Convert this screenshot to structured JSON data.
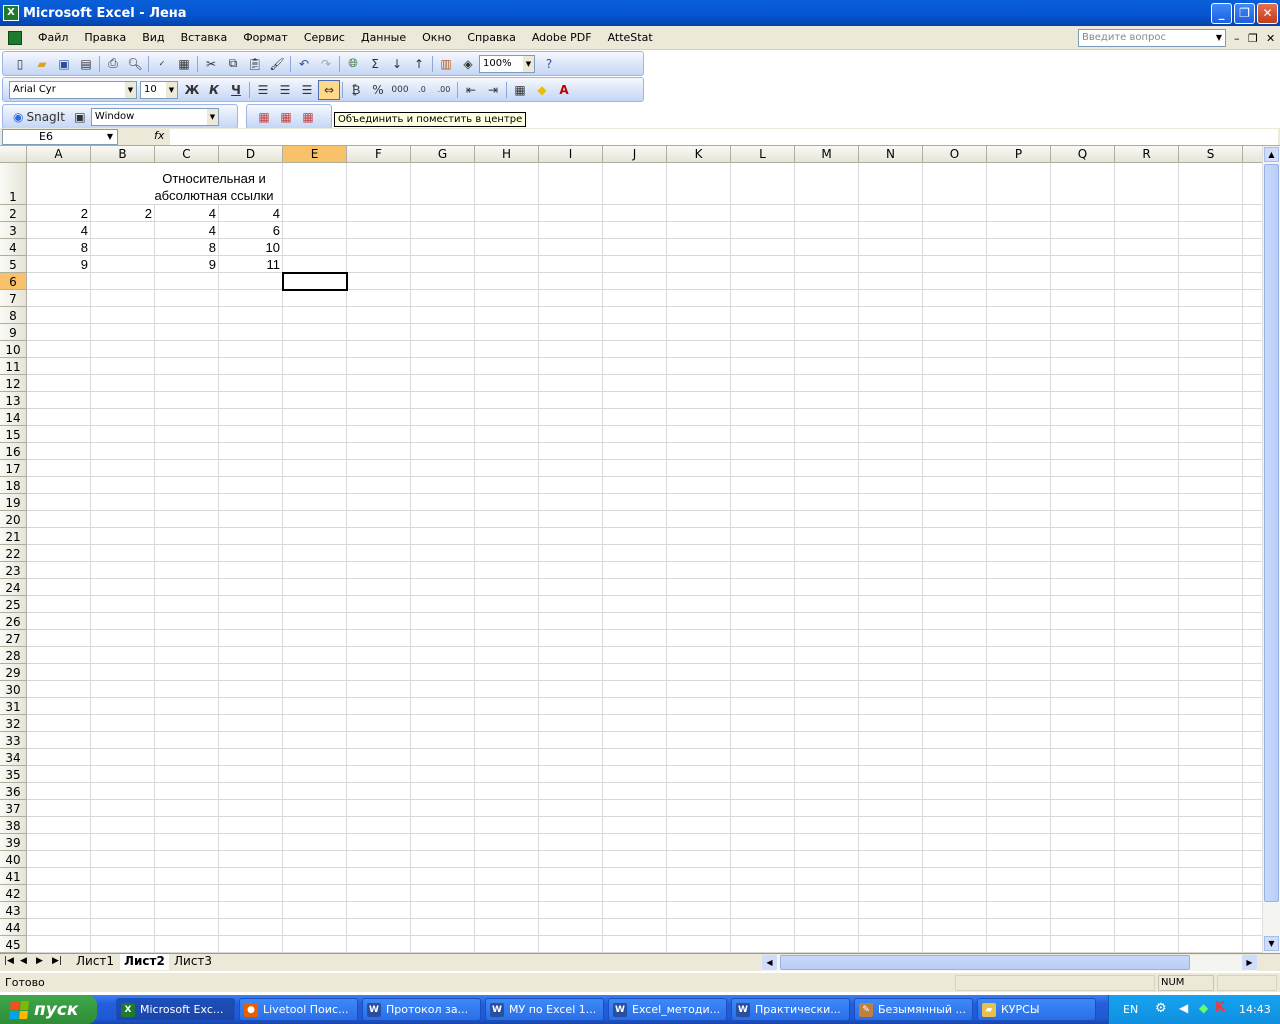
{
  "window": {
    "title": "Microsoft Excel - Лена",
    "app_icon": "excel-icon"
  },
  "menu": [
    "Файл",
    "Правка",
    "Вид",
    "Вставка",
    "Формат",
    "Сервис",
    "Данные",
    "Окно",
    "Справка",
    "Adobe PDF",
    "AtteStat"
  ],
  "ask_placeholder": "Введите вопрос",
  "toolbar": {
    "zoom": "100%",
    "font_name": "Arial Cyr",
    "font_size": "10",
    "bold": "Ж",
    "italic": "К",
    "underline": "Ч",
    "percent": "%",
    "thousands": "000",
    "autosum": "Σ",
    "snagit": "SnagIt",
    "snagit_target": "Window",
    "tooltip": "Объединить и поместить в центре"
  },
  "formula_bar": {
    "name_box": "E6",
    "fx": "fx",
    "content": ""
  },
  "columns": [
    "A",
    "B",
    "C",
    "D",
    "E",
    "F",
    "G",
    "H",
    "I",
    "J",
    "K",
    "L",
    "M",
    "N",
    "O",
    "P",
    "Q",
    "R",
    "S"
  ],
  "active_cell": "E6",
  "cells": {
    "C1": "Относительная и абсолютная ссылки",
    "A2": "2",
    "B2": "2",
    "C2": "4",
    "D2": "4",
    "A3": "4",
    "C3": "4",
    "D3": "6",
    "A4": "8",
    "C4": "8",
    "D4": "10",
    "A5": "9",
    "C5": "9",
    "D5": "11"
  },
  "row_count": 45,
  "sheets": [
    "Лист1",
    "Лист2",
    "Лист3"
  ],
  "active_sheet": "Лист2",
  "status": {
    "ready": "Готово",
    "num": "NUM"
  },
  "taskbar": {
    "start": "пуск",
    "tasks": [
      {
        "label": "Microsoft Exc...",
        "icon": "excel-icon",
        "active": true
      },
      {
        "label": "Livetool Поис...",
        "icon": "firefox-icon"
      },
      {
        "label": "Протокол за...",
        "icon": "word-icon"
      },
      {
        "label": "МУ по Excel 1...",
        "icon": "word-icon"
      },
      {
        "label": "Excel_методи...",
        "icon": "word-icon"
      },
      {
        "label": "Практически...",
        "icon": "word-icon"
      },
      {
        "label": "Безымянный ...",
        "icon": "paint-icon"
      },
      {
        "label": "КУРСЫ",
        "icon": "folder-icon"
      }
    ],
    "lang": "EN",
    "clock": "14:43"
  }
}
